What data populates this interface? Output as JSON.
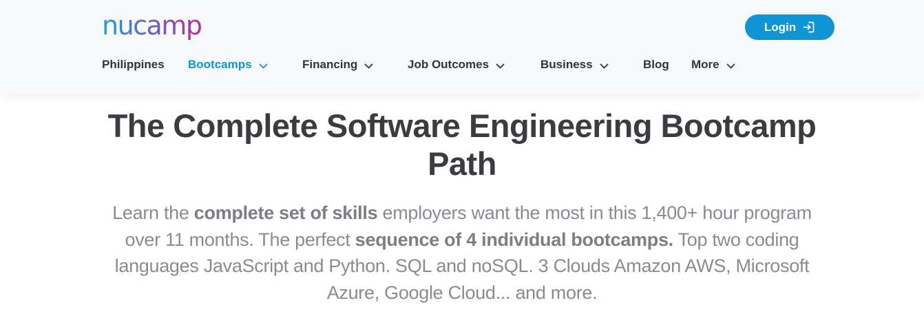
{
  "header": {
    "logo_text": "nucamp",
    "login_label": "Login",
    "nav": [
      {
        "label": "Philippines",
        "has_dropdown": false,
        "active": false
      },
      {
        "label": "Bootcamps",
        "has_dropdown": true,
        "active": true
      },
      {
        "label": "Financing",
        "has_dropdown": true,
        "active": false
      },
      {
        "label": "Job Outcomes",
        "has_dropdown": true,
        "active": false
      },
      {
        "label": "Business",
        "has_dropdown": true,
        "active": false
      },
      {
        "label": "Blog",
        "has_dropdown": false,
        "active": false
      },
      {
        "label": "More",
        "has_dropdown": true,
        "active": false
      }
    ]
  },
  "hero": {
    "title": "The Complete Software Engineering Bootcamp Path",
    "description": {
      "part1": "Learn the ",
      "bold1": "complete set of skills",
      "part2": " employers want the most in this 1,400+ hour program over 11 months. The perfect ",
      "bold2": "sequence of 4 individual bootcamps.",
      "part3": " Top two coding languages JavaScript and Python. SQL and noSQL. 3 Clouds Amazon AWS, Microsoft Azure, Google Cloud... and more."
    }
  },
  "colors": {
    "accent": "#0e95d6",
    "logo_gradient_start": "#1fa2d9",
    "logo_gradient_end": "#b8309b",
    "nav_text": "#333439",
    "title_text": "#3b3c41",
    "body_text": "#8a8b91",
    "header_bg": "#f7f8fa"
  },
  "icons": {
    "login": "login-arrow-icon",
    "dropdown": "chevron-down-icon"
  }
}
